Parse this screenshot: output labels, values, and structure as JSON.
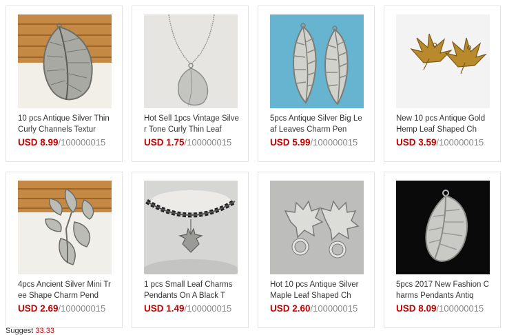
{
  "products": [
    {
      "title": "10 pcs Antique Silver Thin Curly Channels Textur",
      "price": "USD 8.99",
      "rest": "/100000015",
      "image": "silver-leaf-on-wood"
    },
    {
      "title": "Hot Sell 1pcs Vintage Silver Tone Curly Thin Leaf",
      "price": "USD 1.75",
      "rest": "/100000015",
      "image": "leaf-pendant-necklace"
    },
    {
      "title": "5pcs Antique Silver Big Leaf Leaves Charm Pen",
      "price": "USD 5.99",
      "rest": "/100000015",
      "image": "two-silver-leaves"
    },
    {
      "title": "New 10 pcs Antique Gold Hemp Leaf Shaped Ch",
      "price": "USD 3.59",
      "rest": "/100000015",
      "image": "gold-hemp-leaves"
    },
    {
      "title": "4pcs Ancient Silver Mini Tree Shape Charm Pend",
      "price": "USD 2.69",
      "rest": "/100000015",
      "image": "silver-branch-on-wood"
    },
    {
      "title": "1 pcs Small Leaf Charms Pendants On A Black T",
      "price": "USD 1.49",
      "rest": "/100000015",
      "image": "tattoo-choker"
    },
    {
      "title": "Hot 10 pcs Antique Silver Maple Leaf Shaped Ch",
      "price": "USD 2.60",
      "rest": "/100000015",
      "image": "silver-maple-charms"
    },
    {
      "title": "5pcs 2017 New Fashion Charms Pendants Antiq",
      "price": "USD 8.09",
      "rest": "/100000015",
      "image": "silver-leaf-on-black"
    }
  ],
  "footer": {
    "label": "Suggest ",
    "value": "33.33"
  },
  "colors": {
    "price": "#c40000",
    "text": "#333333",
    "border": "#e3e3e3"
  }
}
